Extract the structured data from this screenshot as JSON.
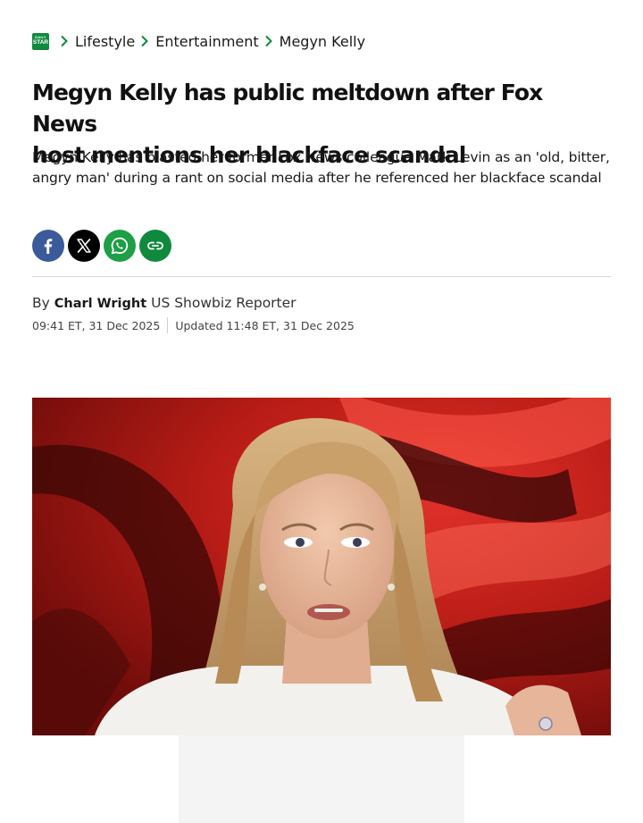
{
  "breadcrumb": {
    "logo_lines": [
      "DAILY",
      "STAR"
    ],
    "items": [
      "Lifestyle",
      "Entertainment",
      "Megyn Kelly"
    ]
  },
  "article": {
    "headline_lines": [
      "Megyn Kelly has public meltdown after Fox News",
      "host mentions her blackface scandal"
    ],
    "standfirst": "Megyn Kelly has blasted her former Fox News colleague Mark Levin as an 'old, bitter, angry man' during a rant on social media after he referenced her blackface scandal",
    "byline_prefix": "By",
    "author": "Charl Wright",
    "author_role": "US Showbiz Reporter",
    "published": "09:41 ET, 31 Dec 2025",
    "updated": "Updated 11:48 ET, 31 Dec 2025"
  },
  "share": {
    "buttons": [
      {
        "icon": "facebook-icon",
        "color": "#3b5a99"
      },
      {
        "icon": "x-icon",
        "color": "#000000"
      },
      {
        "icon": "whatsapp-icon",
        "color": "#1e9e45"
      },
      {
        "icon": "link-icon",
        "color": "#0f8a3c"
      }
    ]
  },
  "colors": {
    "brand_green": "#0f8a3c",
    "text": "#1a1a1a",
    "divider": "#d6d6d6"
  }
}
